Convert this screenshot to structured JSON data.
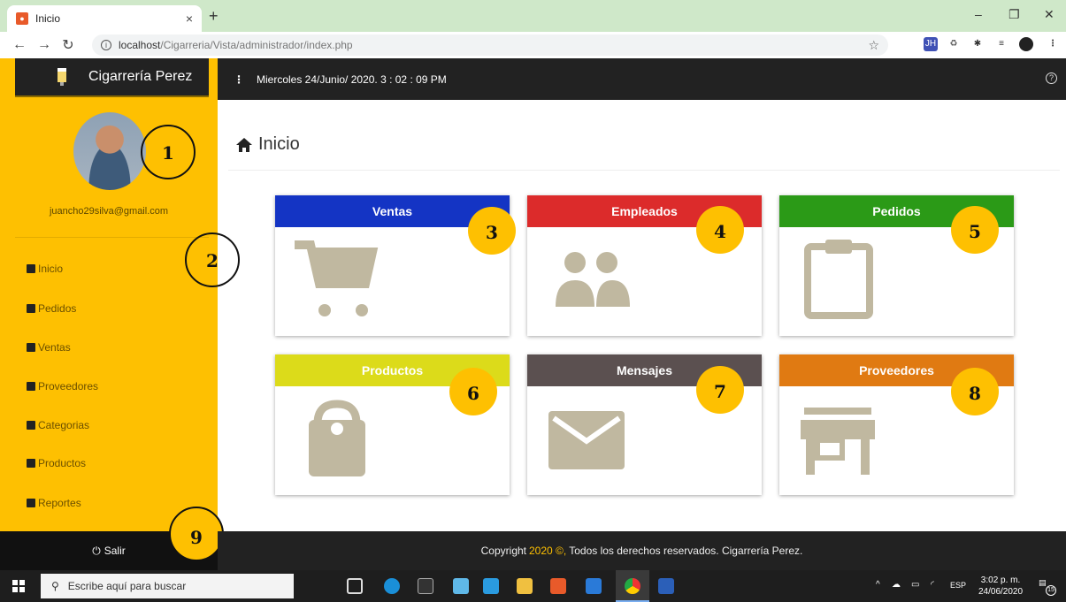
{
  "browser": {
    "tab_title": "Inicio",
    "url_host": "localhost",
    "url_path": "/Cigarreria/Vista/administrador/index.php"
  },
  "app": {
    "brand": "Cigarrería Perez",
    "datetime": "Miercoles 24/Junio/ 2020. 3 : 02 : 09 PM",
    "accent_color": "#fec001"
  },
  "sidebar": {
    "email": "juancho29silva@gmail.com",
    "items": [
      {
        "label": "Inicio",
        "icon": "dashboard-icon"
      },
      {
        "label": "Pedidos",
        "icon": "clipboard-icon"
      },
      {
        "label": "Ventas",
        "icon": "cart-icon"
      },
      {
        "label": "Proveedores",
        "icon": "store-icon"
      },
      {
        "label": "Categorias",
        "icon": "book-icon"
      },
      {
        "label": "Productos",
        "icon": "bag-icon"
      },
      {
        "label": "Reportes",
        "icon": "chart-icon"
      }
    ],
    "logout": "Salir"
  },
  "main": {
    "title": "Inicio",
    "cards": [
      {
        "label": "Ventas",
        "color": "#1434c4",
        "icon": "cart-icon"
      },
      {
        "label": "Empleados",
        "color": "#dc2b2b",
        "icon": "users-icon"
      },
      {
        "label": "Pedidos",
        "color": "#2b9a17",
        "icon": "clipboard-icon"
      },
      {
        "label": "Productos",
        "color": "#dcdb1a",
        "icon": "bag-icon"
      },
      {
        "label": "Mensajes",
        "color": "#5b5050",
        "icon": "envelope-icon"
      },
      {
        "label": "Proveedores",
        "color": "#e07a12",
        "icon": "store-icon"
      }
    ]
  },
  "annotations": [
    "1",
    "2",
    "3",
    "4",
    "5",
    "6",
    "7",
    "8",
    "9"
  ],
  "footer": {
    "prefix": "Copyright",
    "year": "2020 ©,",
    "suffix": "Todos los derechos reservados. Cigarrería Perez."
  },
  "taskbar": {
    "search_placeholder": "Escribe aquí para buscar",
    "language": "ESP",
    "time": "3:02 p. m.",
    "date": "24/06/2020",
    "notification_count": "15"
  }
}
